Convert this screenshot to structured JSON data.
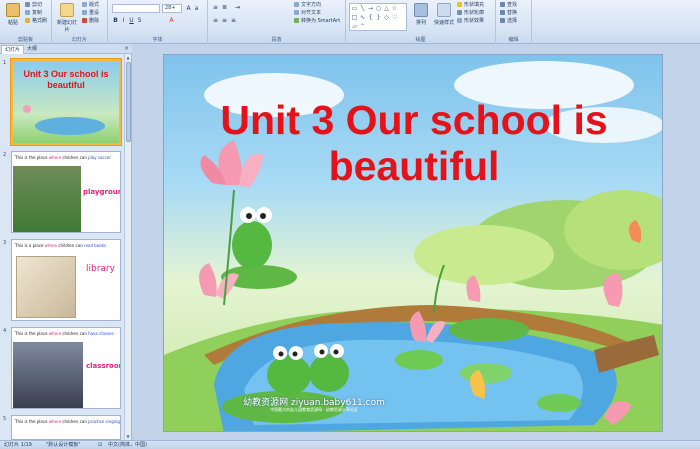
{
  "ribbon": {
    "clipboard": {
      "label": "剪贴板",
      "paste": "粘贴",
      "cut": "剪切",
      "copy": "复制",
      "format_painter": "格式刷"
    },
    "slides": {
      "label": "幻灯片",
      "new_slide": "新建幻灯片",
      "layout": "版式",
      "reset": "重设",
      "delete": "删除"
    },
    "font": {
      "label": "字体",
      "font_size": "28+"
    },
    "paragraph": {
      "label": "段落",
      "text_direction": "文字方向",
      "align_text": "对齐文本",
      "smartart": "转换为 SmartArt"
    },
    "drawing": {
      "label": "绘图",
      "arrange": "排列",
      "quick_styles": "快速样式",
      "shape_fill": "形状填充",
      "shape_outline": "形状轮廓",
      "shape_effects": "形状效果"
    },
    "editing": {
      "label": "编辑",
      "find": "查找",
      "replace": "替换",
      "select": "选择"
    }
  },
  "panel": {
    "tab_slides": "幻灯片",
    "tab_outline": "大纲",
    "close": "×",
    "thumbnails": [
      {
        "num": "1",
        "title": "Unit 3 Our school is beautiful"
      },
      {
        "num": "2",
        "pre": "This is the place ",
        "where": "where",
        "mid": " children can ",
        "act": "play soccer",
        "word": "playground"
      },
      {
        "num": "3",
        "pre": "This is a place ",
        "where": "where",
        "mid": " children can ",
        "act": "read books",
        "word": "library"
      },
      {
        "num": "4",
        "pre": "This is the place ",
        "where": "where",
        "mid": " children can ",
        "act": "have classes",
        "word": "classroom"
      },
      {
        "num": "5",
        "pre": "This is the place ",
        "where": "where",
        "mid": " children can ",
        "act": "practise singing",
        "word": ""
      }
    ]
  },
  "slide": {
    "title": "Unit 3 Our school is beautiful",
    "watermark": "幼教资源网 ziyuan.baby611.com",
    "watermark_sub": "中国最大的幼儿园教育资源网 · 幼教资源分享社区"
  },
  "status": {
    "slide_count": "幻灯片 1/19",
    "theme": "\"默认设计模板\"",
    "language": "中文(简体，中国)"
  },
  "colors": {
    "title_red": "#e4131b",
    "keyword_pink": "#e0247b",
    "selection": "#f4b942"
  }
}
